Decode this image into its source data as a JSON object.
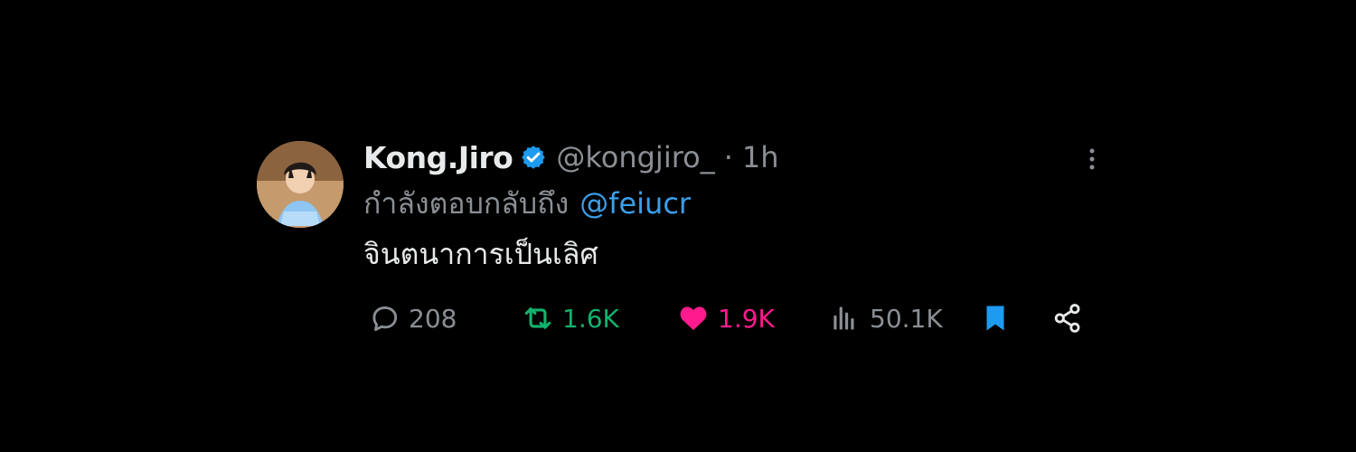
{
  "tweet": {
    "display_name": "Kong.Jiro",
    "handle": "@kongjiro_",
    "separator": "·",
    "time": "1h",
    "reply_label": "กำลังตอบกลับถึง",
    "reply_mention": "@feiucr",
    "text": "จินตนาการเป็นเลิศ"
  },
  "actions": {
    "replies": "208",
    "retweets": "1.6K",
    "likes": "1.9K",
    "views": "50.1K"
  },
  "icons": {
    "verified": "verified-badge-icon",
    "more": "more-vertical-icon",
    "reply": "reply-icon",
    "retweet": "retweet-icon",
    "like": "heart-icon",
    "views": "views-icon",
    "bookmark": "bookmark-icon",
    "share": "share-icon"
  },
  "colors": {
    "background": "#000000",
    "primary_text": "#e7e9ea",
    "secondary_text": "#8b8f94",
    "verified_blue": "#1d9bf0",
    "mention_blue": "#3b9ee8",
    "retweet_green": "#13b26d",
    "like_pink": "#ff1b8d",
    "bookmark_blue": "#1d9bf0"
  }
}
